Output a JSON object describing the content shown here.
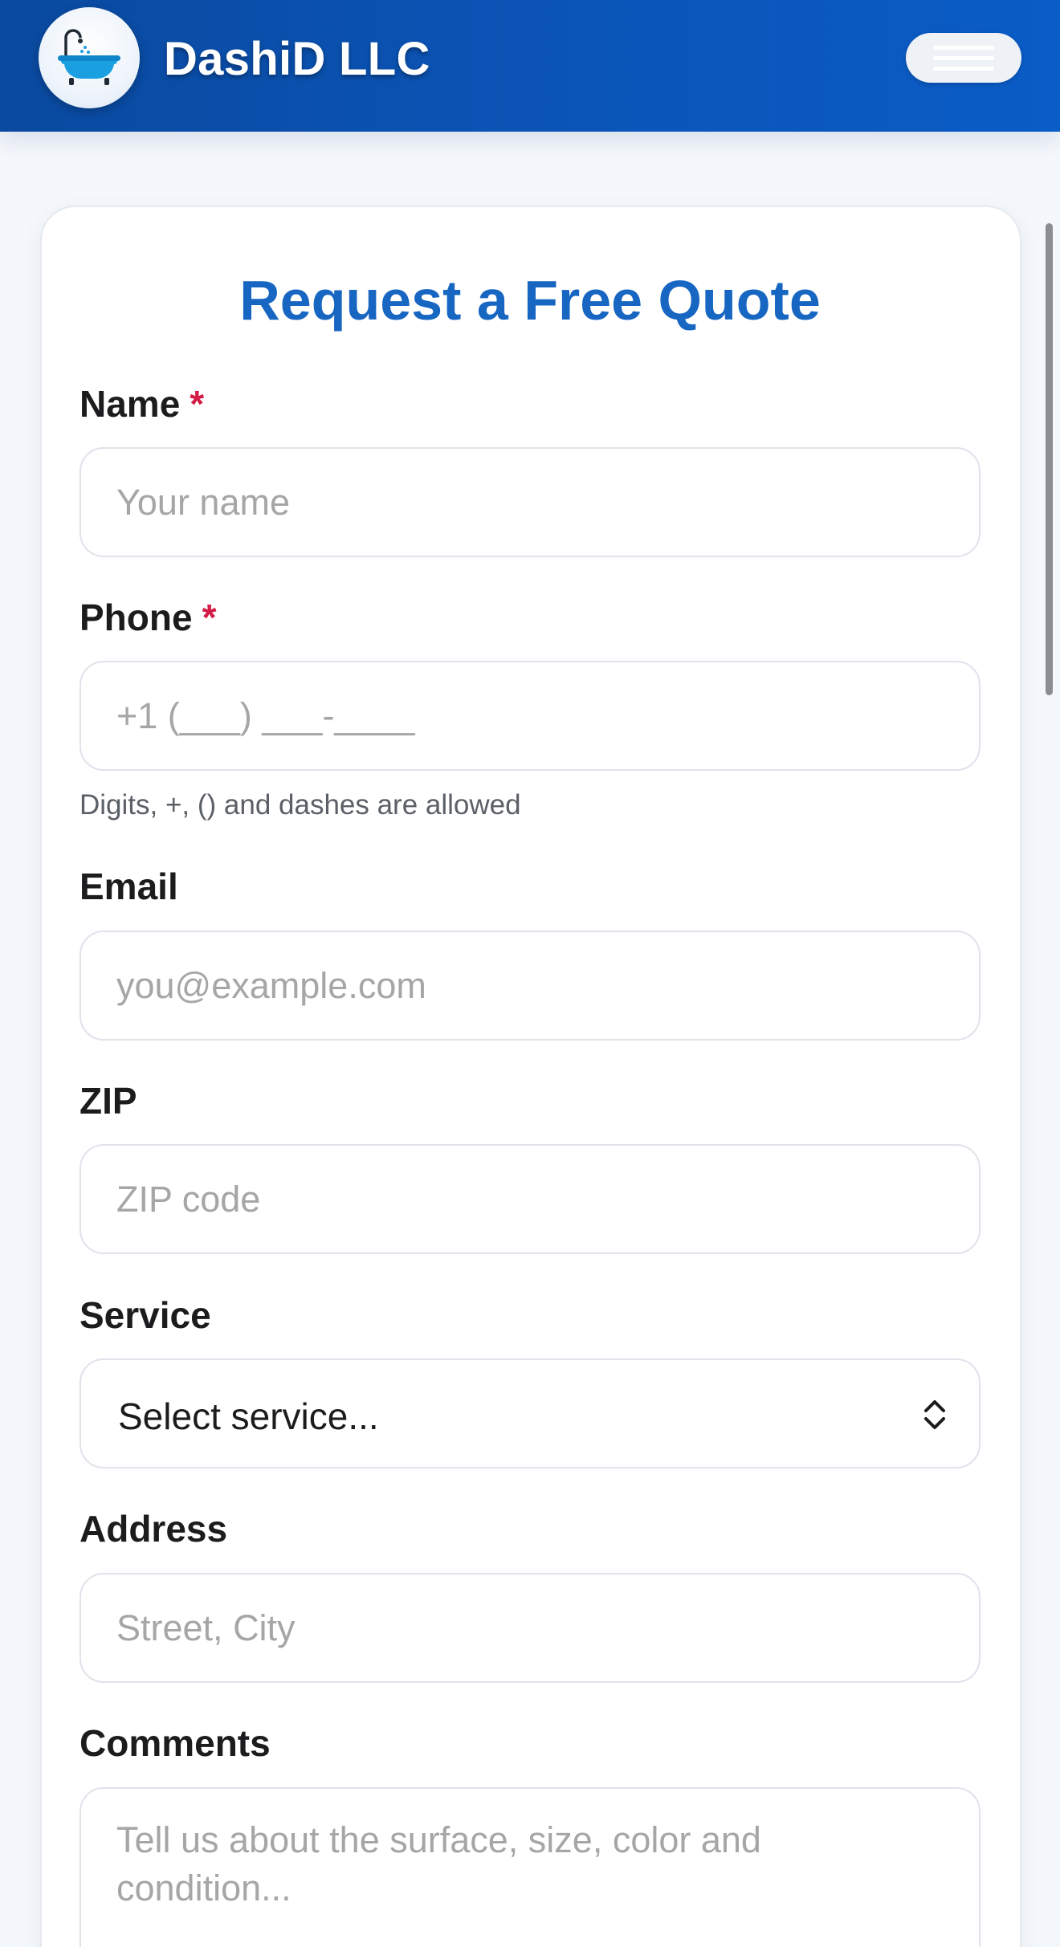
{
  "header": {
    "brand": "DashiD LLC",
    "logo_icon": "bathtub-icon",
    "menu_icon": "hamburger-menu-icon"
  },
  "form": {
    "title": "Request a Free Quote",
    "required_marker": "*",
    "name": {
      "label": "Name",
      "placeholder": "Your name"
    },
    "phone": {
      "label": "Phone",
      "placeholder": "+1 (___) ___-____",
      "hint": "Digits, +, () and dashes are allowed"
    },
    "email": {
      "label": "Email",
      "placeholder": "you@example.com"
    },
    "zip": {
      "label": "ZIP",
      "placeholder": "ZIP code"
    },
    "service": {
      "label": "Service",
      "value": "Select service..."
    },
    "address": {
      "label": "Address",
      "placeholder": "Street, City"
    },
    "comments": {
      "label": "Comments",
      "placeholder": "Tell us about the surface, size, color and condition..."
    }
  },
  "colors": {
    "header": "#0b55b8",
    "title": "#1766c2",
    "required": "#d41c45",
    "tub": "#1aa0e0"
  }
}
